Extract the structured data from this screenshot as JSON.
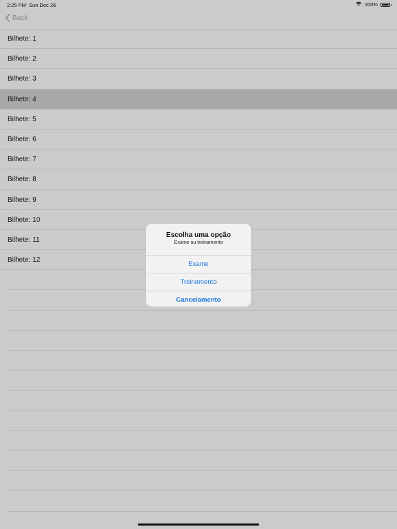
{
  "status": {
    "time": "2:25 PM",
    "date": "Sun Dec 26",
    "battery": "100%",
    "battery_level": 1.0
  },
  "nav": {
    "back_label": "Back"
  },
  "list": {
    "items": [
      {
        "label": "Bilhete: 1"
      },
      {
        "label": "Bilhete: 2"
      },
      {
        "label": "Bilhete: 3"
      },
      {
        "label": "Bilhete: 4"
      },
      {
        "label": "Bilhete: 5"
      },
      {
        "label": "Bilhete: 6"
      },
      {
        "label": "Bilhete: 7"
      },
      {
        "label": "Bilhete: 8"
      },
      {
        "label": "Bilhete: 9"
      },
      {
        "label": "Bilhete: 10"
      },
      {
        "label": "Bilhete: 11"
      },
      {
        "label": "Bilhete: 12"
      }
    ],
    "selected_index": 3
  },
  "alert": {
    "title": "Escolha uma opção",
    "message": "Exame ou treinamento",
    "actions": [
      {
        "label": "Exame"
      },
      {
        "label": "Treinamento"
      },
      {
        "label": "Cancelamento"
      }
    ]
  },
  "colors": {
    "accent": "#1a78d9",
    "selected_row": "#a8a8ab"
  }
}
